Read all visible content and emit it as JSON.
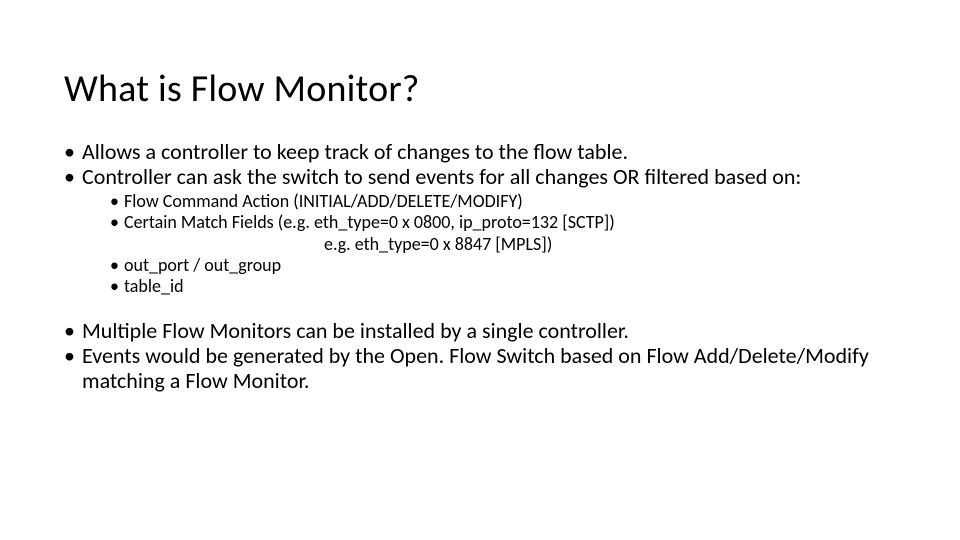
{
  "slide": {
    "title": "What is Flow Monitor?",
    "bullets1": {
      "b0": "Allows a controller to keep track of changes to the flow table.",
      "b1": "Controller can ask the switch to send events for all changes OR filtered based on:",
      "b2": "Multiple Flow Monitors can be installed by a single controller.",
      "b3": "Events would be generated by the Open. Flow Switch based on Flow Add/Delete/Modify matching a Flow Monitor."
    },
    "bullets2": {
      "s0": "Flow Command Action (INITIAL/ADD/DELETE/MODIFY)",
      "s1a": "Certain Match Fields (e.g. eth_type=0 x 0800, ip_proto=132 [SCTP])",
      "s1b": "e.g. eth_type=0 x 8847 [MPLS])",
      "s2": "out_port / out_group",
      "s3": "table_id"
    }
  }
}
